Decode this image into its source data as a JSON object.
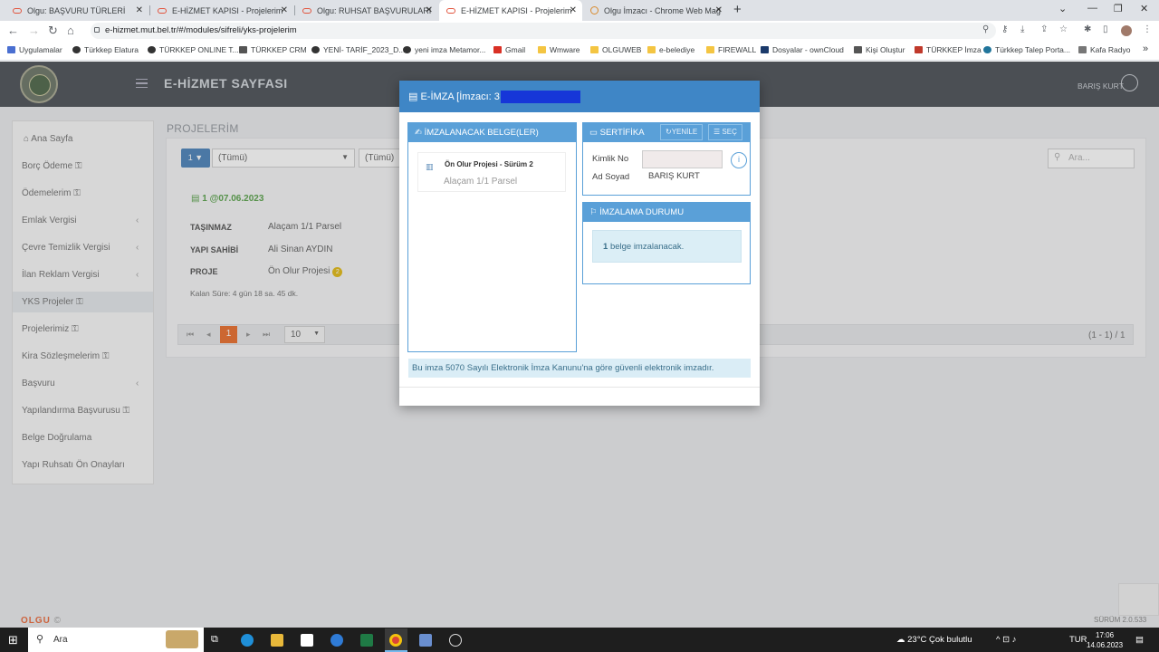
{
  "browser": {
    "tabs": [
      {
        "title": "Olgu: BAŞVURU TÜRLERİ",
        "close": "✕"
      },
      {
        "title": "E-HİZMET KAPISI - Projelerim",
        "close": "✕"
      },
      {
        "title": "Olgu: RUHSAT BAŞVURULARI",
        "close": "✕"
      },
      {
        "title": "E-HİZMET KAPISI - Projelerim",
        "close": "✕"
      },
      {
        "title": "Olgu İmzacı - Chrome Web Mağ...",
        "close": "✕"
      }
    ],
    "new_tab": "+",
    "url": "e-hizmet.mut.bel.tr/#/modules/sifreli/yks-projelerim",
    "bookmarks": [
      "Uygulamalar",
      "Türkkep Elatura",
      "TÜRKKEP ONLINE T...",
      "TÜRKKEP CRM",
      "YENİ- TARİF_2023_D...",
      "yeni imza Metamor...",
      "Gmail",
      "Wmware",
      "OLGUWEB",
      "e-belediye",
      "FIREWALL",
      "Dosyalar - ownCloud",
      "Kişi Oluştur",
      "TÜRKKEP İmza",
      "Türkkep Talep Porta...",
      "Kafa Radyo"
    ]
  },
  "app": {
    "title": "E-HİZMET SAYFASI",
    "user": "BARIŞ KURT",
    "page_title": "PROJELERİM",
    "brand": "OLGU",
    "version": "SÜRÜM 2.0.533"
  },
  "sidebar": {
    "items": [
      "Ana Sayfa",
      "Borç Ödeme",
      "Ödemelerim",
      "Emlak Vergisi",
      "Çevre Temizlik Vergisi",
      "İlan Reklam Vergisi",
      "YKS Projeler",
      "Projelerimiz",
      "Kira Sözleşmelerim",
      "Başvuru",
      "Yapılandırma Başvurusu",
      "Belge Doğrulama",
      "Yapı Ruhsatı Ön Onayları"
    ]
  },
  "filters": {
    "button": "1 ▼",
    "select1": "(Tümü)",
    "select2": "(Tümü)",
    "search_placeholder": "Ara..."
  },
  "record": {
    "date": "1 @07.06.2023",
    "fields": [
      {
        "label": "TAŞINMAZ",
        "value": "Alaçam 1/1 Parsel"
      },
      {
        "label": "YAPI SAHİBİ",
        "value": "Ali Sinan AYDIN"
      },
      {
        "label": "PROJE",
        "value": "Ön Olur Projesi"
      }
    ],
    "badge": "2",
    "remaining": "Kalan Süre: 4 gün 18 sa. 45 dk."
  },
  "pager": {
    "current": "1",
    "page_size": "10",
    "info": "(1 - 1) / 1"
  },
  "modal": {
    "title": "E-İMZA [İmzacı: 3",
    "documents": {
      "header": "İMZALANACAK BELGE(LER)",
      "items": [
        {
          "title": "Ön Olur Projesi - Sürüm 2",
          "subtitle": "Alaçam 1/1 Parsel"
        }
      ]
    },
    "certificate": {
      "header": "SERTİFİKA",
      "refresh": "YENİLE",
      "select": "SEÇ",
      "id_label": "Kimlik No",
      "name_label": "Ad Soyad",
      "name_value": "BARIŞ KURT"
    },
    "status": {
      "header": "İMZALAMA DURUMU",
      "count": "1",
      "message": "belge imzalanacak."
    },
    "footnote": "Bu imza 5070 Sayılı Elektronik İmza Kanunu'na göre güvenli elektronik imzadır."
  },
  "taskbar": {
    "search": "Ara",
    "weather": "23°C  Çok bulutlu",
    "lang": "TUR",
    "time": "17:06",
    "date": "14.06.2023"
  },
  "colors": {
    "accent": "#3f86c6",
    "header": "#3c4249",
    "brand": "#e85c2a"
  }
}
